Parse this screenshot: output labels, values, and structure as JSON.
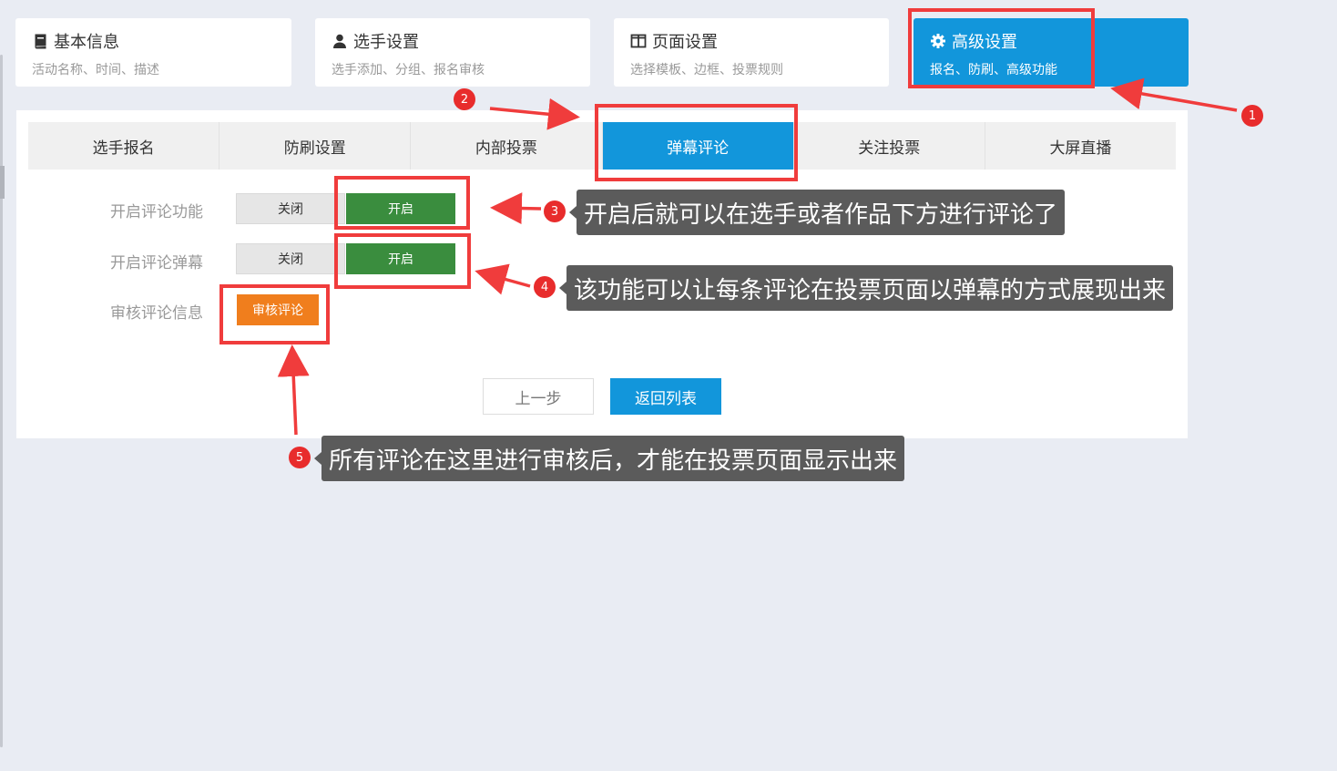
{
  "steps": [
    {
      "title": "基本信息",
      "sub": "活动名称、时间、描述",
      "icon": "book-icon"
    },
    {
      "title": "选手设置",
      "sub": "选手添加、分组、报名审核",
      "icon": "user-icon"
    },
    {
      "title": "页面设置",
      "sub": "选择模板、边框、投票规则",
      "icon": "columns-icon"
    },
    {
      "title": "高级设置",
      "sub": "报名、防刷、高级功能",
      "icon": "gear-icon"
    }
  ],
  "tabs": [
    "选手报名",
    "防刷设置",
    "内部投票",
    "弹幕评论",
    "关注投票",
    "大屏直播"
  ],
  "active_tab": "弹幕评论",
  "form": {
    "row1_label": "开启评论功能",
    "row2_label": "开启评论弹幕",
    "row3_label": "审核评论信息",
    "off_label": "关闭",
    "on_label": "开启",
    "review_label": "审核评论"
  },
  "footer": {
    "prev_label": "上一步",
    "back_label": "返回列表"
  },
  "annotations": [
    {
      "num": "1",
      "text": ""
    },
    {
      "num": "2",
      "text": ""
    },
    {
      "num": "3",
      "text": "开启后就可以在选手或者作品下方进行评论了"
    },
    {
      "num": "4",
      "text": "该功能可以让每条评论在投票页面以弹幕的方式展现出来"
    },
    {
      "num": "5",
      "text": "所有评论在这里进行审核后，才能在投票页面显示出来"
    }
  ],
  "colors": {
    "primary": "#1296db",
    "green": "#3a8d3e",
    "orange": "#f07e1d",
    "highlight": "#f03c3c"
  }
}
